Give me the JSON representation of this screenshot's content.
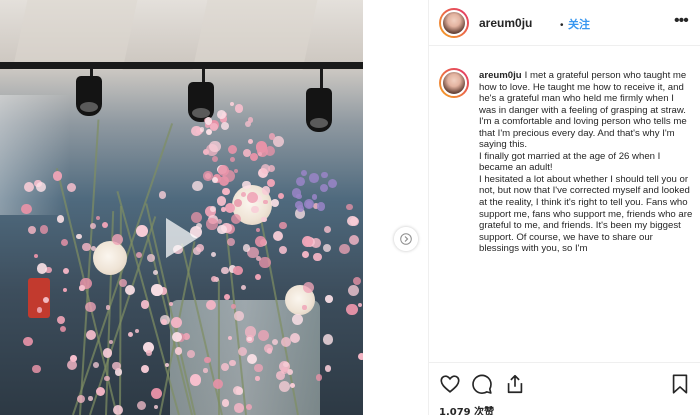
{
  "post": {
    "username": "areum0ju",
    "separator": "•",
    "follow_label": "关注",
    "more_label": "•••",
    "caption": "I met a grateful person who taught me how to love. He taught me how to receive it, and he's a grateful man who held me firmly when I was in danger with a feeling of grasping at straw. I'm a comfortable and loving person who tells me that I'm precious every day. And that's why I'm saying this.\nI finally got married at the age of 26 when I became an adult!\nI hesitated a lot about whether I should tell you or not, but now that I've corrected myself and looked at the reality, I think it's right to tell you. Fans who support me, fans who support me, friends who are grateful to me, and friends. It's been my biggest support. Of course, we have to share our blessings with you, so I'm",
    "likes": "1,079 次赞"
  },
  "icons": {
    "play": "play-icon",
    "next": "chevron-right-icon",
    "like": "heart-icon",
    "comment": "comment-icon",
    "share": "share-icon",
    "save": "bookmark-icon",
    "more": "more-icon"
  },
  "colors": {
    "accent": "#3897f0",
    "text": "#262626",
    "border": "#efefef"
  }
}
